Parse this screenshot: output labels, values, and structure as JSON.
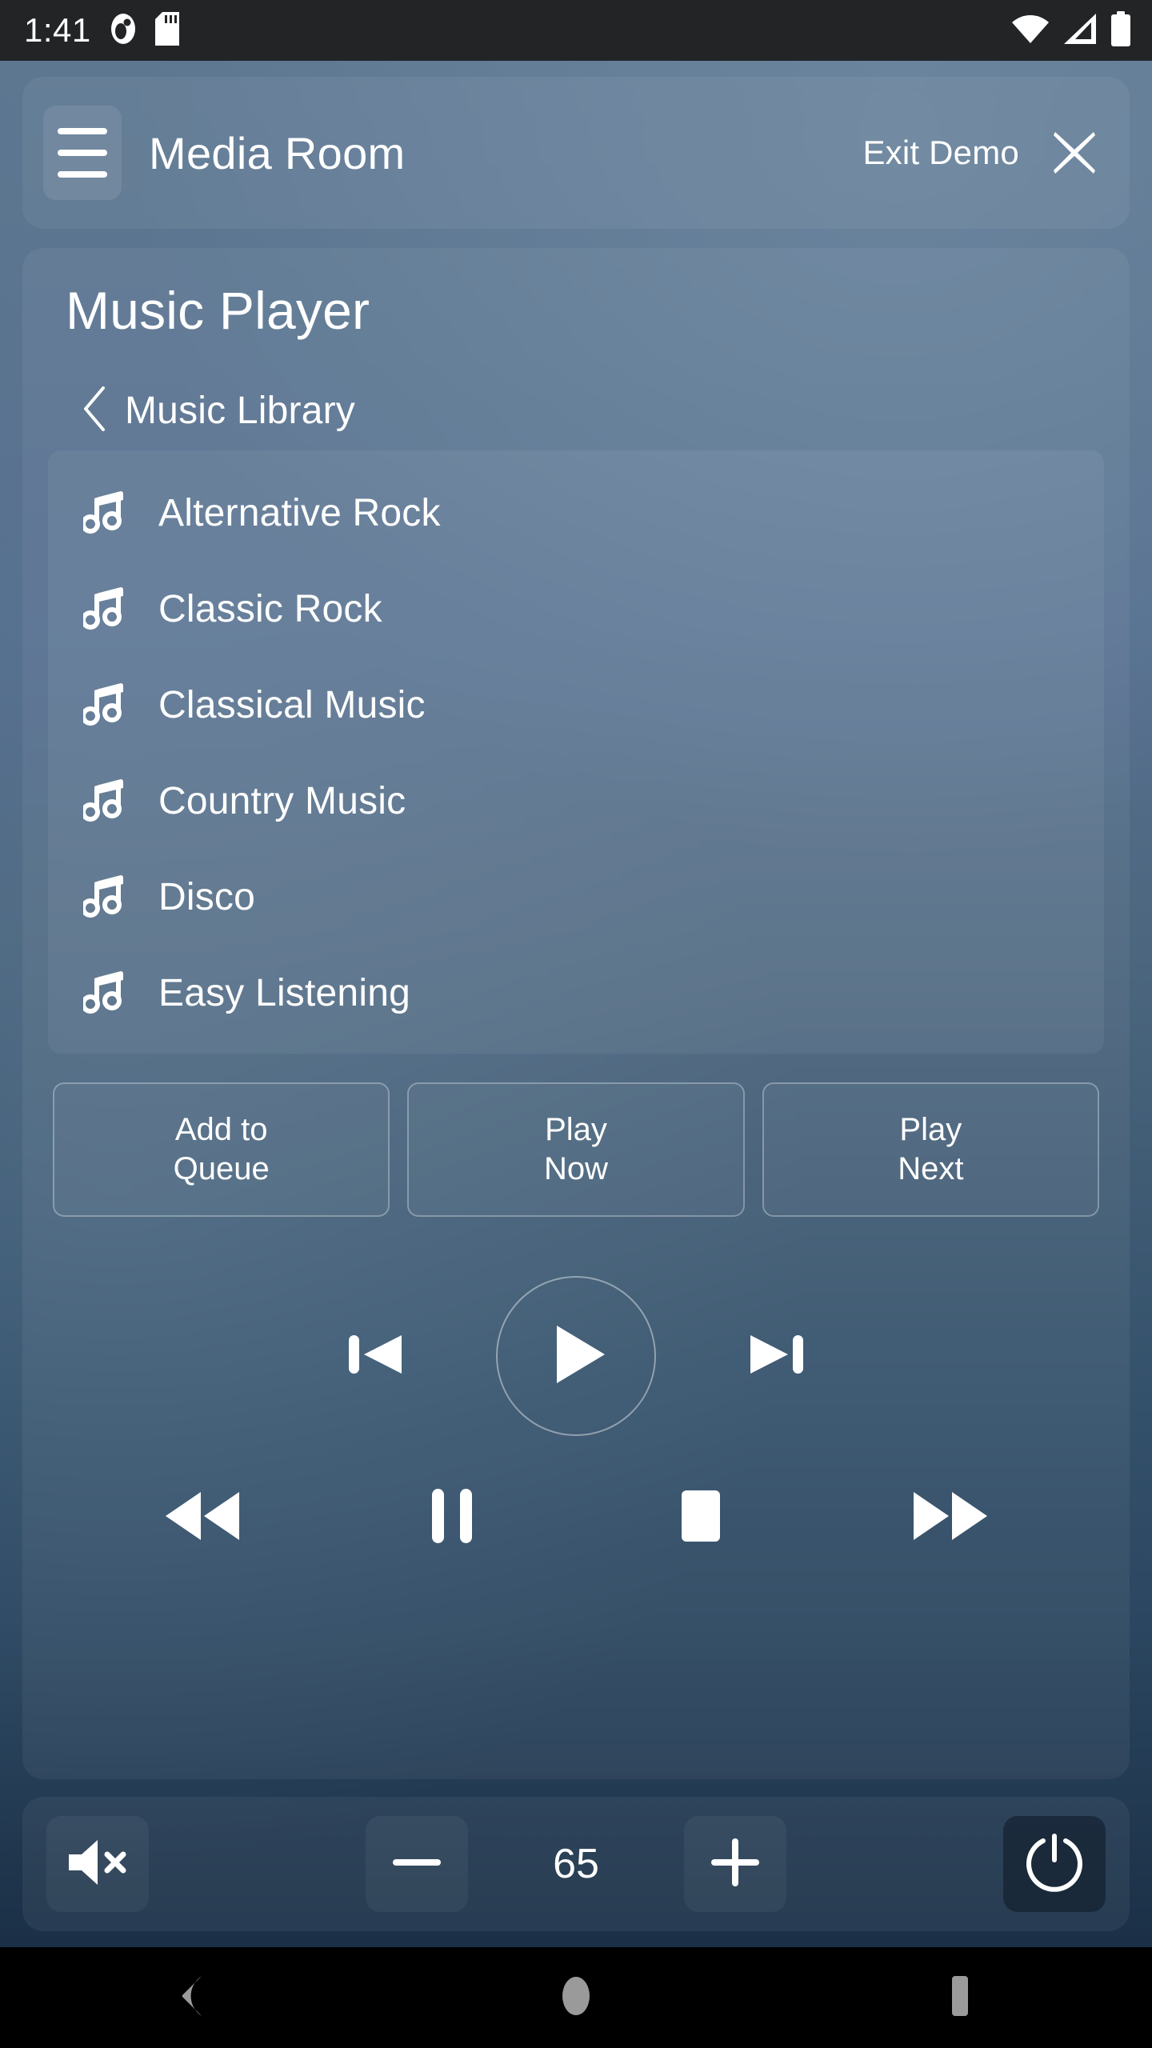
{
  "status_bar": {
    "time": "1:41",
    "left_icons": [
      "screenshot-app-icon",
      "sd-card-icon"
    ],
    "right_icons": [
      "wifi-icon",
      "cellular-signal-icon",
      "battery-icon"
    ]
  },
  "header": {
    "menu_icon": "hamburger-menu-icon",
    "room_title": "Media Room",
    "exit_label": "Exit Demo",
    "close_icon": "close-x-icon"
  },
  "player": {
    "title": "Music Player",
    "breadcrumb": {
      "back_icon": "chevron-left-icon",
      "label": "Music Library"
    },
    "list_icon": "music-note-icon",
    "items": [
      {
        "label": "Alternative Rock"
      },
      {
        "label": "Classic Rock"
      },
      {
        "label": "Classical Music"
      },
      {
        "label": "Country Music"
      },
      {
        "label": "Disco"
      },
      {
        "label": "Easy Listening"
      }
    ],
    "actions": [
      {
        "line1": "Add to",
        "line2": "Queue"
      },
      {
        "line1": "Play",
        "line2": "Now"
      },
      {
        "line1": "Play",
        "line2": "Next"
      }
    ],
    "transport_primary": [
      {
        "icon": "previous-track-icon"
      },
      {
        "icon": "play-icon"
      },
      {
        "icon": "next-track-icon"
      }
    ],
    "transport_secondary": [
      {
        "icon": "rewind-icon"
      },
      {
        "icon": "pause-icon"
      },
      {
        "icon": "stop-icon"
      },
      {
        "icon": "fast-forward-icon"
      }
    ]
  },
  "volume": {
    "mute_icon": "volume-mute-icon",
    "minus_icon": "minus-icon",
    "value": "65",
    "plus_icon": "plus-icon",
    "power_icon": "power-icon"
  },
  "nav_bar": {
    "back_icon": "android-back-icon",
    "home_icon": "android-home-icon",
    "recents_icon": "android-recents-icon"
  },
  "colors": {
    "status_bar_bg": "#222426",
    "wallpaper_top": "#5d7791",
    "wallpaper_bottom": "#1b3047",
    "text": "#ffffff",
    "nav_bar_bg": "#000000",
    "nav_icon": "#9a9a9a"
  }
}
